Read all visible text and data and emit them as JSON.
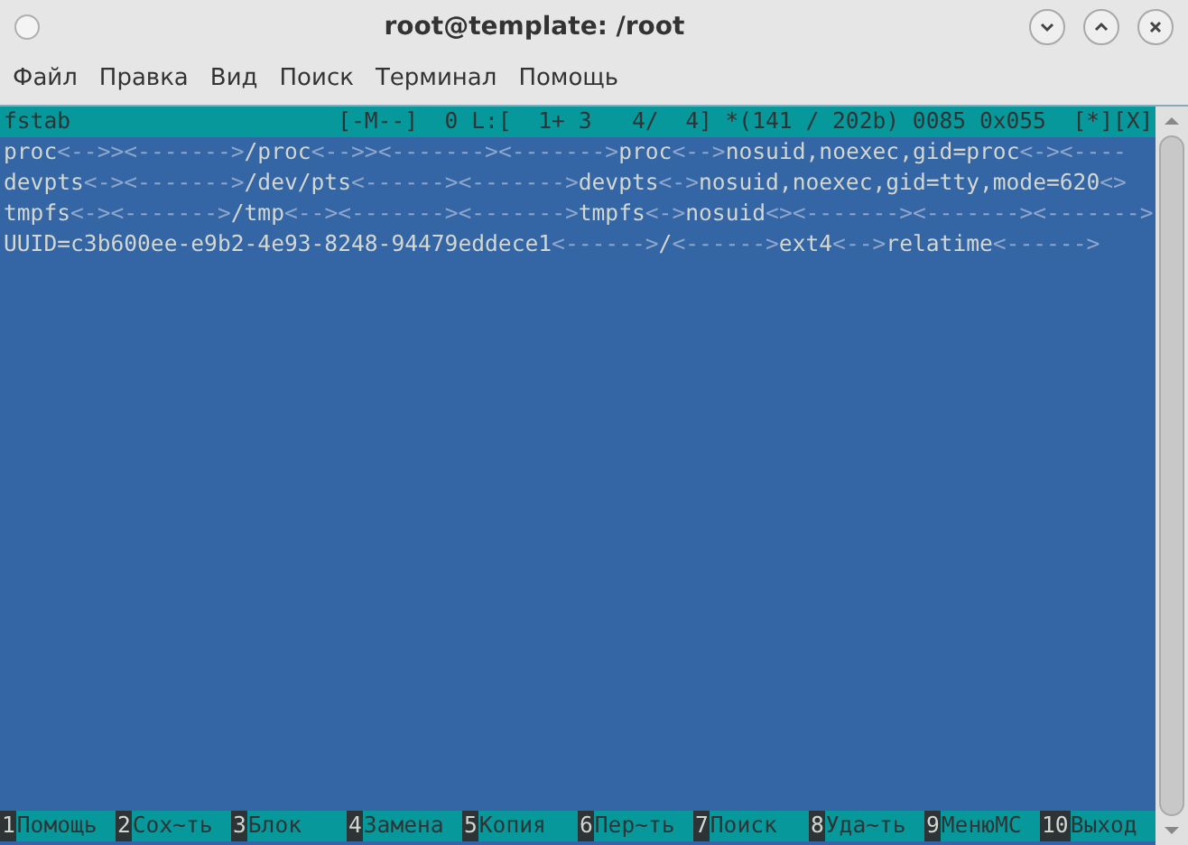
{
  "window": {
    "title": "root@template: /root"
  },
  "menu": [
    "Файл",
    "Правка",
    "Вид",
    "Поиск",
    "Терминал",
    "Помощь"
  ],
  "editor": {
    "status": "fstab                    [-M--]  0 L:[  1+ 3   4/  4] *(141 / 202b) 0085 0x055  [*][X]",
    "lines": [
      [
        {
          "kind": "text",
          "text": "proc"
        },
        {
          "kind": "tab",
          "text": "<-->><------->"
        },
        {
          "kind": "text",
          "text": "/proc"
        },
        {
          "kind": "tab",
          "text": "<-->><-------><------->"
        },
        {
          "kind": "text",
          "text": "proc"
        },
        {
          "kind": "tab",
          "text": "<-->"
        },
        {
          "kind": "text",
          "text": "nosuid,noexec,gid=proc"
        },
        {
          "kind": "tab",
          "text": "<-><----"
        }
      ],
      [
        {
          "kind": "text",
          "text": "devpts"
        },
        {
          "kind": "tab",
          "text": "<-><------->"
        },
        {
          "kind": "text",
          "text": "/dev/pts"
        },
        {
          "kind": "tab",
          "text": "<------><------->"
        },
        {
          "kind": "text",
          "text": "devpts"
        },
        {
          "kind": "tab",
          "text": "<->"
        },
        {
          "kind": "text",
          "text": "nosuid,noexec,gid=tty,mode=620"
        },
        {
          "kind": "tab",
          "text": "<>"
        }
      ],
      [
        {
          "kind": "text",
          "text": "tmpfs"
        },
        {
          "kind": "tab",
          "text": "<-><------->"
        },
        {
          "kind": "text",
          "text": "/tmp"
        },
        {
          "kind": "tab",
          "text": "<--><-------><------->"
        },
        {
          "kind": "text",
          "text": "tmpfs"
        },
        {
          "kind": "tab",
          "text": "<->"
        },
        {
          "kind": "text",
          "text": "nosuid"
        },
        {
          "kind": "tab",
          "text": "<><-------><-------><------->"
        }
      ],
      [
        {
          "kind": "text",
          "text": "UUID=c3b600ee-e9b2-4e93-8248-94479eddece1"
        },
        {
          "kind": "tab",
          "text": "<------>"
        },
        {
          "kind": "text",
          "text": "/"
        },
        {
          "kind": "tab",
          "text": "<------>"
        },
        {
          "kind": "text",
          "text": "ext4"
        },
        {
          "kind": "tab",
          "text": "<-->"
        },
        {
          "kind": "text",
          "text": "relatime"
        },
        {
          "kind": "tab",
          "text": "<------>"
        }
      ]
    ]
  },
  "function_keys": [
    {
      "key": "1",
      "label": "Помощь"
    },
    {
      "key": "2",
      "label": "Сох~ть"
    },
    {
      "key": "3",
      "label": "Блок"
    },
    {
      "key": "4",
      "label": "Замена"
    },
    {
      "key": "5",
      "label": "Копия"
    },
    {
      "key": "6",
      "label": "Пер~ть"
    },
    {
      "key": "7",
      "label": "Поиск"
    },
    {
      "key": "8",
      "label": "Уда~ть"
    },
    {
      "key": "9",
      "label": "МенюMC"
    },
    {
      "key": "10",
      "label": "Выход"
    }
  ]
}
